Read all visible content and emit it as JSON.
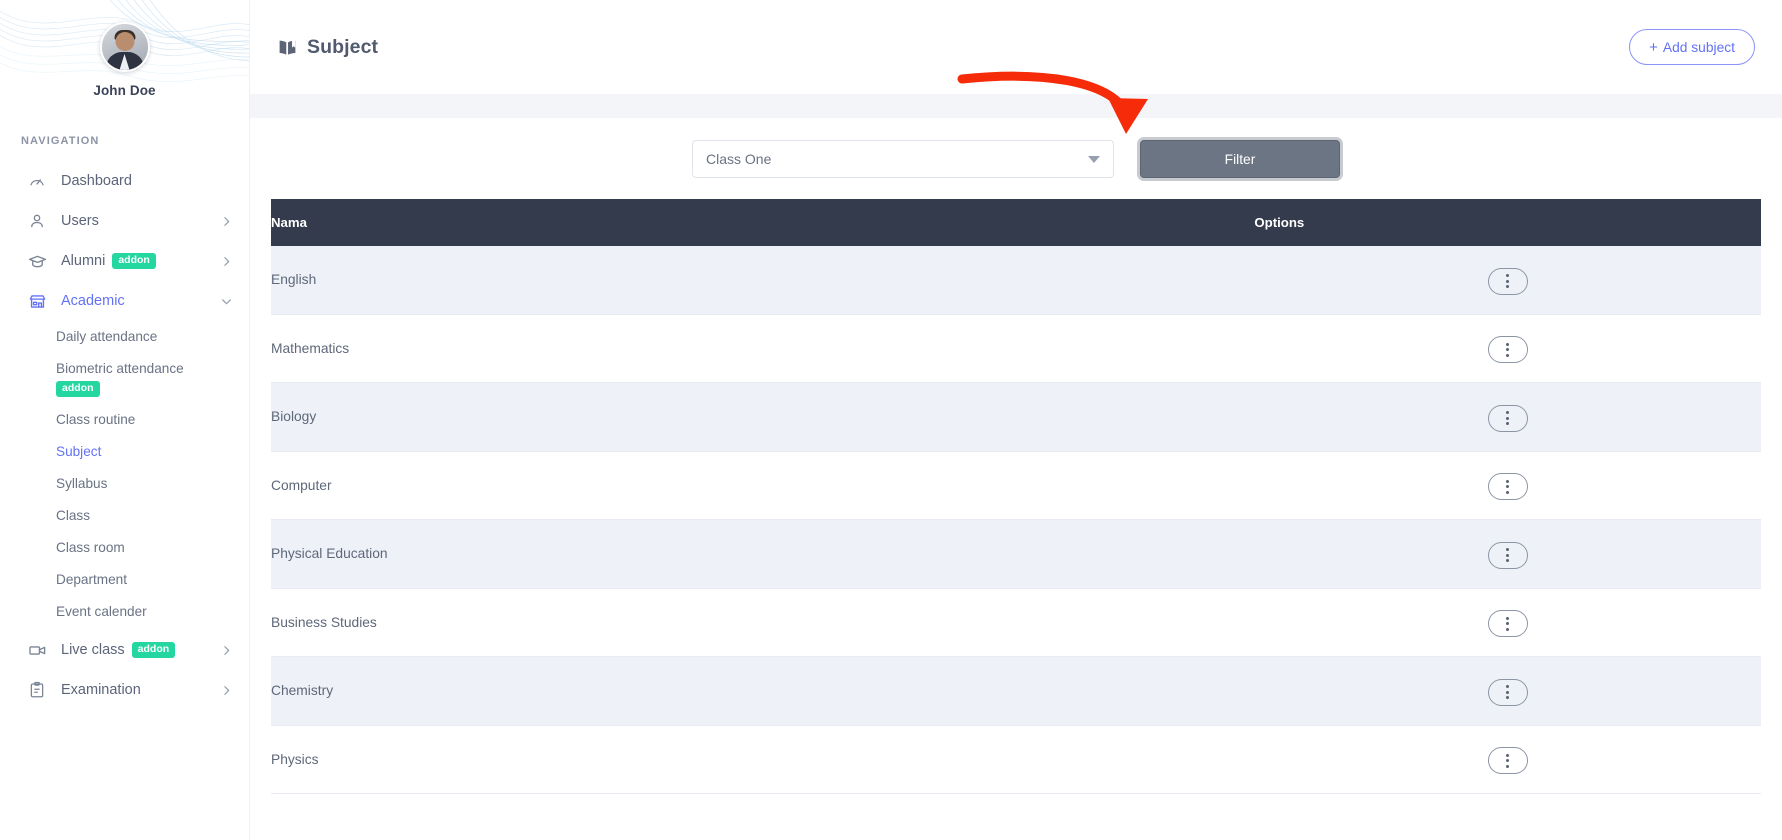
{
  "sidebar": {
    "profile": {
      "name": "John Doe",
      "avatar_icon": "user-avatar"
    },
    "section_title": "NAVIGATION",
    "items": [
      {
        "label": "Dashboard",
        "icon": "speedometer-icon",
        "has_chevron": false,
        "badge": null,
        "active": false
      },
      {
        "label": "Users",
        "icon": "user-icon",
        "has_chevron": true,
        "badge": null,
        "active": false
      },
      {
        "label": "Alumni",
        "icon": "graduation-cap-icon",
        "has_chevron": true,
        "badge": "addon",
        "active": false
      },
      {
        "label": "Academic",
        "icon": "school-building-icon",
        "has_chevron": true,
        "badge": null,
        "active": true
      },
      {
        "label": "Live class",
        "icon": "video-camera-icon",
        "has_chevron": true,
        "badge": "addon",
        "active": false
      },
      {
        "label": "Examination",
        "icon": "clipboard-icon",
        "has_chevron": true,
        "badge": null,
        "active": false
      }
    ],
    "academic_submenu": [
      {
        "label": "Daily attendance",
        "badge": null,
        "active": false
      },
      {
        "label": "Biometric attendance",
        "badge": "addon",
        "active": false
      },
      {
        "label": "Class routine",
        "badge": null,
        "active": false
      },
      {
        "label": "Subject",
        "badge": null,
        "active": true
      },
      {
        "label": "Syllabus",
        "badge": null,
        "active": false
      },
      {
        "label": "Class",
        "badge": null,
        "active": false
      },
      {
        "label": "Class room",
        "badge": null,
        "active": false
      },
      {
        "label": "Department",
        "badge": null,
        "active": false
      },
      {
        "label": "Event calender",
        "badge": null,
        "active": false
      }
    ]
  },
  "topbar": {
    "title": "Subject",
    "title_icon": "book-icon",
    "add_button": {
      "plus": "+",
      "label": "Add subject"
    }
  },
  "filter_bar": {
    "class_select": {
      "value": "Class One",
      "caret_icon": "chevron-down-icon"
    },
    "filter_button": "Filter"
  },
  "table": {
    "headers": {
      "name": "Nama",
      "options": "Options"
    },
    "rows": [
      {
        "name": "English"
      },
      {
        "name": "Mathematics"
      },
      {
        "name": "Biology"
      },
      {
        "name": "Computer"
      },
      {
        "name": "Physical Education"
      },
      {
        "name": "Business Studies"
      },
      {
        "name": "Chemistry"
      },
      {
        "name": "Physics"
      }
    ],
    "row_action_icon": "kebab-menu-icon"
  },
  "annotation": {
    "arrow_icon": "red-curved-arrow",
    "color": "#f52b0a",
    "points_to": "Filter"
  },
  "colors": {
    "accent_indigo": "#6372f5",
    "badge_green": "#24d6a0",
    "table_header_dark": "#343b4d",
    "filter_gray": "#6c7584",
    "row_stripe": "#eef1f8",
    "page_bg": "#f4f5f9"
  }
}
